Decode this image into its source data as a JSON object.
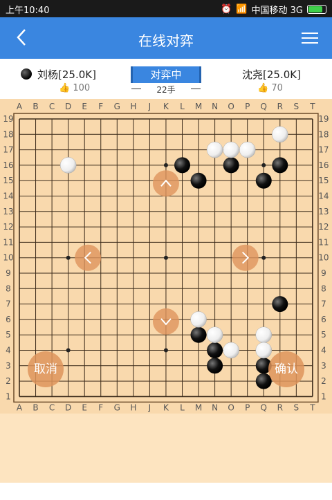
{
  "status_bar": {
    "time": "上午10:40",
    "carrier": "中国移动 3G"
  },
  "nav": {
    "title": "在线对弈"
  },
  "player_black": {
    "name": "刘杨[25.0K]",
    "likes": "100"
  },
  "player_white": {
    "name": "沈尧[25.0K]",
    "likes": "70"
  },
  "game": {
    "status": "对弈中",
    "moves": "22手"
  },
  "board": {
    "columns": [
      "A",
      "B",
      "C",
      "D",
      "E",
      "F",
      "G",
      "H",
      "J",
      "K",
      "L",
      "M",
      "N",
      "O",
      "P",
      "Q",
      "R",
      "S",
      "T"
    ],
    "rows": [
      "19",
      "18",
      "17",
      "16",
      "15",
      "14",
      "13",
      "12",
      "11",
      "10",
      "9",
      "8",
      "7",
      "6",
      "5",
      "4",
      "3",
      "2",
      "1"
    ],
    "black_stones": [
      "L16",
      "M15",
      "O16",
      "Q15",
      "R16",
      "R7",
      "M5",
      "N4",
      "N3",
      "Q3",
      "Q2"
    ],
    "white_stones": [
      "R18",
      "N17",
      "O17",
      "P17",
      "D16",
      "M6",
      "N5",
      "O4",
      "Q5",
      "Q4"
    ]
  },
  "buttons": {
    "cancel": "取消",
    "confirm": "确认"
  }
}
